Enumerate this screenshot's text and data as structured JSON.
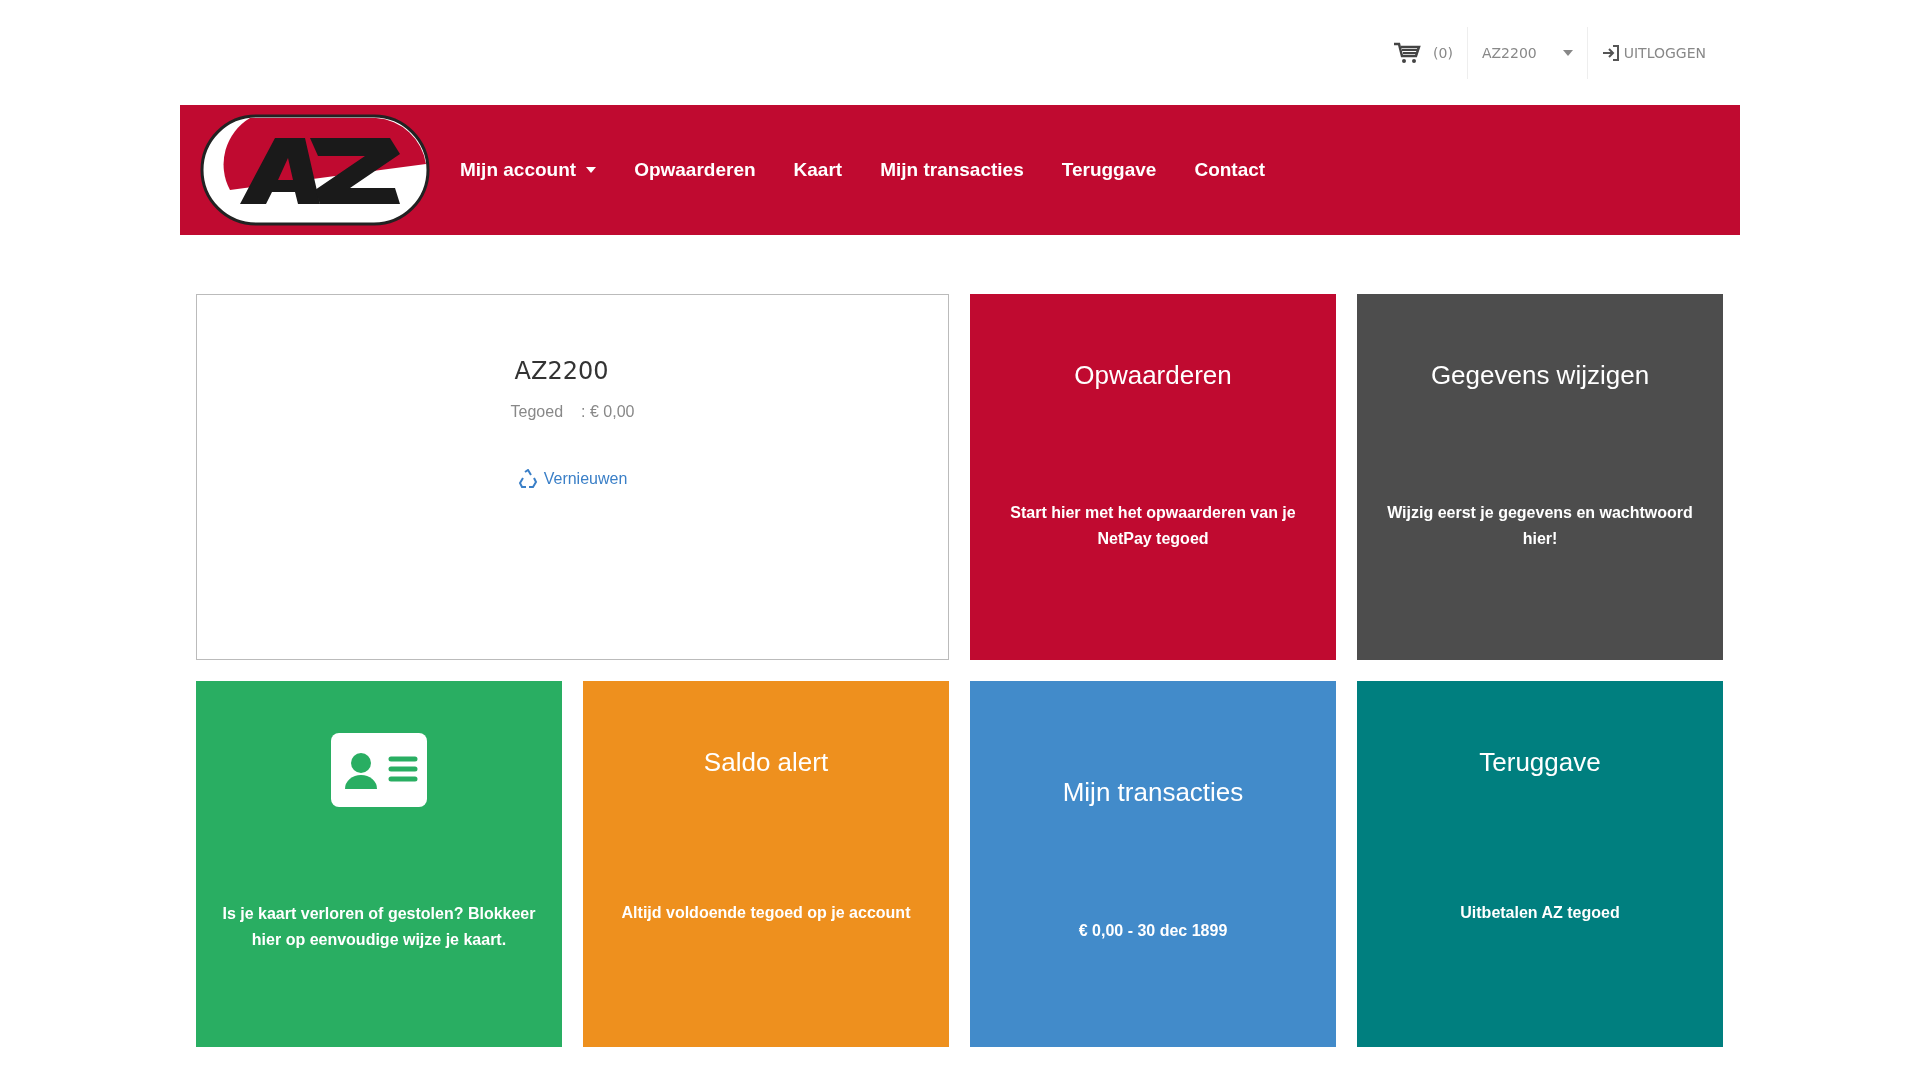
{
  "topbar": {
    "cart_count": "(0)",
    "user": "AZ2200",
    "logout": "UITLOGGEN"
  },
  "nav": [
    {
      "label": "Mijn account",
      "caret": true
    },
    {
      "label": "Opwaarderen",
      "caret": false
    },
    {
      "label": "Kaart",
      "caret": false
    },
    {
      "label": "Mijn transacties",
      "caret": false
    },
    {
      "label": "Teruggave",
      "caret": false
    },
    {
      "label": "Contact",
      "caret": false
    }
  ],
  "account": {
    "name": "AZ2200",
    "balance_label": "Tegoed",
    "balance": ": € 0,00",
    "refresh": "Vernieuwen"
  },
  "tiles": [
    {
      "kind": "title",
      "color": "#c00a30",
      "title": "Opwaarderen",
      "text": "Start hier met het opwaarderen van je NetPay tegoed"
    },
    {
      "kind": "title",
      "color": "#4d4d4d",
      "title": "Gegevens wijzigen",
      "text": "Wijzig eerst je gegevens en wachtwoord hier!"
    },
    {
      "kind": "icon",
      "color": "#29ae62",
      "text": "Is je kaart verloren of gestolen? Blokkeer hier op eenvoudige wijze je kaart."
    },
    {
      "kind": "title",
      "color": "#ee901e",
      "title": "Saldo alert",
      "text": "Altijd voldoende tegoed op je account"
    },
    {
      "kind": "stat",
      "color": "#428bca",
      "title": "Mijn transacties",
      "text": "€ 0,00 - 30 dec 1899"
    },
    {
      "kind": "title",
      "color": "#007f7f",
      "title": "Teruggave",
      "text": "Uitbetalen AZ tegoed"
    }
  ]
}
